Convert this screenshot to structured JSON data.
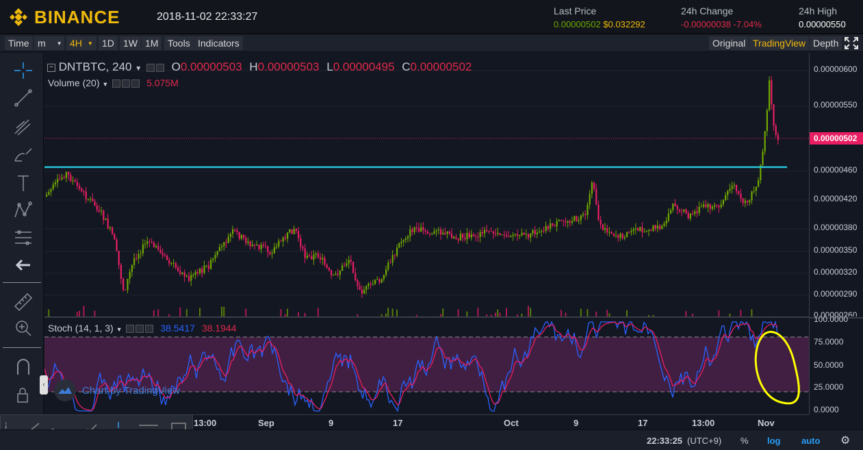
{
  "header": {
    "brand": "BINANCE",
    "datetime": "2018-11-02 22:33:27",
    "last_price_label": "Last Price",
    "last_price_btc": "0.00000502",
    "last_price_usd": "$0.032292",
    "change_label": "24h Change",
    "change_value": "-0.00000038",
    "change_pct": "-7.04%",
    "high_label": "24h High",
    "high_value": "0.00000550"
  },
  "toolbar": {
    "time": "Time",
    "minute": "m",
    "interval_4h": "4H",
    "interval_1d": "1D",
    "interval_1w": "1W",
    "interval_1m": "1M",
    "tools": "Tools",
    "indicators": "Indicators",
    "original": "Original",
    "tradingview": "TradingView",
    "depth": "Depth"
  },
  "legend": {
    "symbol": "DNTBTC, 240",
    "o_label": "O",
    "o_value": "0.00000503",
    "h_label": "H",
    "h_value": "0.00000503",
    "l_label": "L",
    "l_value": "0.00000495",
    "c_label": "C",
    "c_value": "0.00000502",
    "volume_label": "Volume (20)",
    "volume_value": "5.075M",
    "stoch_label": "Stoch (14, 1, 3)",
    "stoch_k": "38.5417",
    "stoch_d": "38.1944"
  },
  "price_axis": [
    "0.00000600",
    "0.00000550",
    "0.00000460",
    "0.00000420",
    "0.00000380",
    "0.00000350",
    "0.00000320",
    "0.00000290",
    "0.00000260"
  ],
  "current_price_tag": "0.00000502",
  "stoch_axis": [
    "100.0000",
    "75.0000",
    "50.0000",
    "25.0000",
    "0.0000"
  ],
  "time_axis": [
    "13:00",
    "Sep",
    "9",
    "17",
    "Oct",
    "9",
    "17",
    "13:00",
    "Nov"
  ],
  "watermark": "Chart by TradingView",
  "status": {
    "time": "22:33:25",
    "timezone": "(UTC+9)",
    "percent": "%",
    "log": "log",
    "auto": "auto"
  },
  "colors": {
    "up": "#70a800",
    "down": "#e91e63",
    "resistance_line": "#26c6da",
    "stoch_k": "#2962ff",
    "stoch_d": "#e91e63",
    "annotation": "#ffff00",
    "accent": "#f0b90b"
  },
  "icons": [
    "crosshair-icon",
    "trend-line-icon",
    "pitchfork-icon",
    "brush-icon",
    "text-icon",
    "pattern-icon",
    "fib-icon",
    "back-arrow-icon",
    "ruler-icon",
    "zoom-icon",
    "magnet-icon",
    "lock-icon"
  ]
}
